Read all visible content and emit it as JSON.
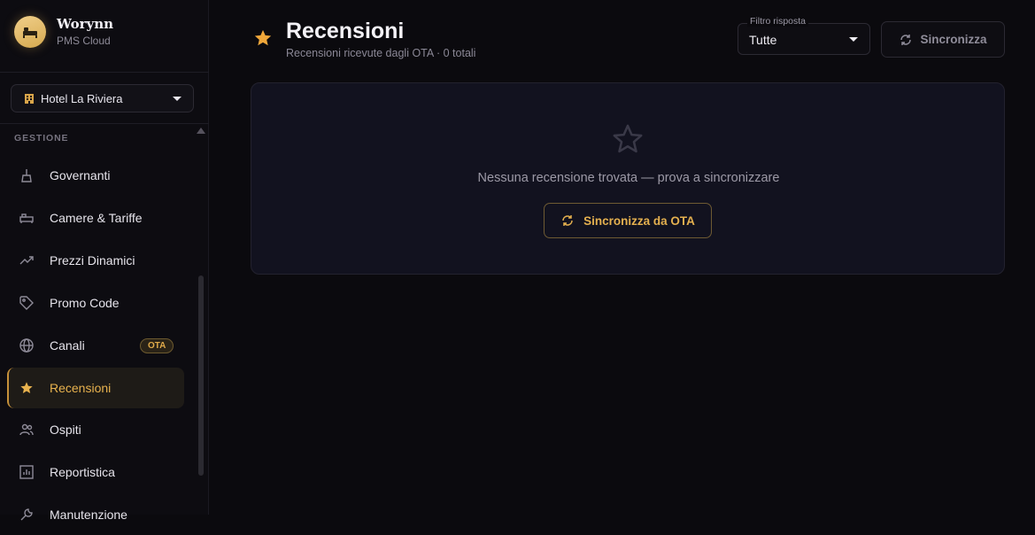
{
  "brand": {
    "name": "Worynn",
    "subtitle": "PMS Cloud",
    "logo_icon": "bed-icon"
  },
  "hotel_selector": {
    "value": "Hotel La Riviera",
    "icon": "hotel-building-icon"
  },
  "sidebar": {
    "section_title": "GESTIONE",
    "items": [
      {
        "label": "Governanti",
        "icon": "broom-icon"
      },
      {
        "label": "Camere & Tariffe",
        "icon": "bed-icon"
      },
      {
        "label": "Prezzi Dinamici",
        "icon": "trending-up-icon"
      },
      {
        "label": "Promo Code",
        "icon": "tag-icon"
      },
      {
        "label": "Canali",
        "icon": "globe-icon",
        "badge": "OTA"
      },
      {
        "label": "Recensioni",
        "icon": "star-icon",
        "active": true
      },
      {
        "label": "Ospiti",
        "icon": "people-icon"
      },
      {
        "label": "Reportistica",
        "icon": "chart-icon"
      },
      {
        "label": "Manutenzione",
        "icon": "wrench-icon"
      }
    ]
  },
  "header": {
    "title": "Recensioni",
    "subtitle": "Recensioni ricevute dagli OTA · 0 totali",
    "filter": {
      "label": "Filtro risposta",
      "value": "Tutte"
    },
    "sync_button": "Sincronizza"
  },
  "empty_state": {
    "message": "Nessuna recensione trovata — prova a sincronizzare",
    "button": "Sincronizza da OTA"
  },
  "colors": {
    "accent": "#e8b24e",
    "background": "#0b0a0e",
    "card": "#12121f"
  }
}
